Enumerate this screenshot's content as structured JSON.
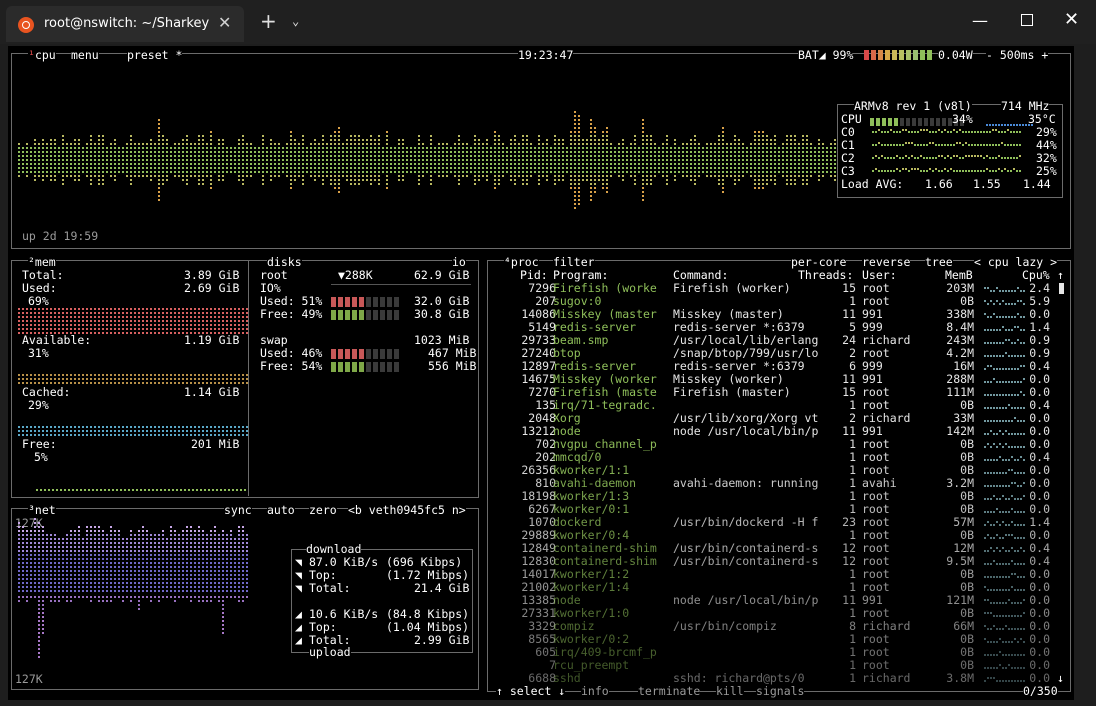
{
  "window": {
    "tab_title": "root@nswitch: ~/Sharkey",
    "new_tab": "+",
    "dropdown": "⌄",
    "minimize": "—",
    "close": "✕"
  },
  "cpu": {
    "header_cpu": "¹cpu",
    "header_menu": "menu",
    "header_preset": "preset *",
    "clock": "19:23:47",
    "battery_label": "BAT◢ 99%",
    "power": "0.04W",
    "interval": "- 500ms +",
    "uptime": "up 2d 19:59",
    "model": "ARMv8 rev 1 (v8l)",
    "freq": "714 MHz",
    "cores": [
      {
        "label": "CPU",
        "pct": "34%",
        "temp": "35°C",
        "value": 0.34
      },
      {
        "label": "C0",
        "pct": "29%",
        "value": 0.29
      },
      {
        "label": "C1",
        "pct": "44%",
        "value": 0.44
      },
      {
        "label": "C2",
        "pct": "32%",
        "value": 0.32
      },
      {
        "label": "C3",
        "pct": "25%",
        "value": 0.25
      }
    ],
    "load_label": "Load AVG:",
    "load": [
      "1.66",
      "1.55",
      "1.44"
    ]
  },
  "mem": {
    "header": "²mem",
    "total_label": "Total:",
    "total": "3.89 GiB",
    "used_label": "Used:",
    "used": "2.69 GiB",
    "used_pct": "69%",
    "avail_label": "Available:",
    "avail": "1.19 GiB",
    "avail_pct": "31%",
    "cached_label": "Cached:",
    "cached": "1.14 GiB",
    "cached_pct": "29%",
    "free_label": "Free:",
    "free": "201 MiB",
    "free_pct": "5%"
  },
  "disks": {
    "header": "disks",
    "io": "io",
    "root_label": "root",
    "root_io": "▼288K",
    "root_size": "62.9 GiB",
    "io_label": "IO%",
    "used_label": "Used: 51%",
    "used": "32.0 GiB",
    "used_value": 0.51,
    "free_label": "Free: 49%",
    "free": "30.8 GiB",
    "free_value": 0.49,
    "swap_label": "swap",
    "swap_size": "1023 MiB",
    "swap_used_label": "Used: 46%",
    "swap_used": "467 MiB",
    "swap_used_value": 0.46,
    "swap_free_label": "Free: 54%",
    "swap_free": "556 MiB",
    "swap_free_value": 0.54
  },
  "net": {
    "header": "³net",
    "sync": "sync",
    "auto": "auto",
    "zero": "zero",
    "iface": "<b veth0945fc5 n>",
    "scale_top": "127K",
    "scale_bottom": "127K",
    "download_title": "download",
    "dl_rate": "87.0 KiB/s",
    "dl_kbps": "(696 Kibps)",
    "dl_top_label": "Top:",
    "dl_top": "(1.72 Mibps)",
    "dl_total_label": "Total:",
    "dl_total": "21.4 GiB",
    "ul_rate": "10.6 KiB/s",
    "ul_kbps": "(84.8 Kibps)",
    "ul_top_label": "Top:",
    "ul_top": "(1.04 Mibps)",
    "ul_total_label": "Total:",
    "ul_total": "2.99 GiB",
    "upload_title": "upload"
  },
  "proc": {
    "header": "⁴proc",
    "filter": "filter",
    "per_core": "per-core",
    "reverse": "reverse",
    "tree": "tree",
    "sort": "< cpu lazy >",
    "columns": [
      "Pid:",
      "Program:",
      "Command:",
      "Threads:",
      "User:",
      "MemB",
      "Cpu%"
    ],
    "rows": [
      {
        "pid": "7296",
        "prog": "Firefish (worke",
        "cmd": "Firefish (worker)",
        "thr": "15",
        "user": "root",
        "mem": "203M",
        "cpu": "2.4"
      },
      {
        "pid": "207",
        "prog": "sugov:0",
        "cmd": "",
        "thr": "1",
        "user": "root",
        "mem": "0B",
        "cpu": "5.9"
      },
      {
        "pid": "14086",
        "prog": "Misskey (master",
        "cmd": "Misskey (master)",
        "thr": "11",
        "user": "991",
        "mem": "338M",
        "cpu": "0.0"
      },
      {
        "pid": "5149",
        "prog": "redis-server",
        "cmd": "redis-server *:6379",
        "thr": "5",
        "user": "999",
        "mem": "8.4M",
        "cpu": "1.4"
      },
      {
        "pid": "29733",
        "prog": "beam.smp",
        "cmd": "/usr/local/lib/erlang",
        "thr": "24",
        "user": "richard",
        "mem": "243M",
        "cpu": "0.9"
      },
      {
        "pid": "27240",
        "prog": "btop",
        "cmd": "/snap/btop/799/usr/lo",
        "thr": "2",
        "user": "root",
        "mem": "4.2M",
        "cpu": "0.9"
      },
      {
        "pid": "12897",
        "prog": "redis-server",
        "cmd": "redis-server *:6379",
        "thr": "6",
        "user": "999",
        "mem": "16M",
        "cpu": "0.4"
      },
      {
        "pid": "14675",
        "prog": "Misskey (worker",
        "cmd": "Misskey (worker)",
        "thr": "11",
        "user": "991",
        "mem": "288M",
        "cpu": "0.0"
      },
      {
        "pid": "7270",
        "prog": "Firefish (maste",
        "cmd": "Firefish (master)",
        "thr": "15",
        "user": "root",
        "mem": "111M",
        "cpu": "0.0"
      },
      {
        "pid": "135",
        "prog": "irq/71-tegradc.",
        "cmd": "",
        "thr": "1",
        "user": "root",
        "mem": "0B",
        "cpu": "0.4"
      },
      {
        "pid": "2048",
        "prog": "Xorg",
        "cmd": "/usr/lib/xorg/Xorg vt",
        "thr": "2",
        "user": "richard",
        "mem": "33M",
        "cpu": "0.0"
      },
      {
        "pid": "13212",
        "prog": "node",
        "cmd": "node /usr/local/bin/p",
        "thr": "11",
        "user": "991",
        "mem": "142M",
        "cpu": "0.0"
      },
      {
        "pid": "702",
        "prog": "nvgpu_channel_p",
        "cmd": "",
        "thr": "1",
        "user": "root",
        "mem": "0B",
        "cpu": "0.0"
      },
      {
        "pid": "202",
        "prog": "mmcqd/0",
        "cmd": "",
        "thr": "1",
        "user": "root",
        "mem": "0B",
        "cpu": "0.4"
      },
      {
        "pid": "26356",
        "prog": "kworker/1:1",
        "cmd": "",
        "thr": "1",
        "user": "root",
        "mem": "0B",
        "cpu": "0.0"
      },
      {
        "pid": "810",
        "prog": "avahi-daemon",
        "cmd": "avahi-daemon: running",
        "thr": "1",
        "user": "avahi",
        "mem": "3.2M",
        "cpu": "0.0"
      },
      {
        "pid": "18198",
        "prog": "kworker/1:3",
        "cmd": "",
        "thr": "1",
        "user": "root",
        "mem": "0B",
        "cpu": "0.0"
      },
      {
        "pid": "6267",
        "prog": "kworker/0:1",
        "cmd": "",
        "thr": "1",
        "user": "root",
        "mem": "0B",
        "cpu": "0.0"
      },
      {
        "pid": "1070",
        "prog": "dockerd",
        "cmd": "/usr/bin/dockerd -H f",
        "thr": "23",
        "user": "root",
        "mem": "57M",
        "cpu": "1.4"
      },
      {
        "pid": "29889",
        "prog": "kworker/0:4",
        "cmd": "",
        "thr": "1",
        "user": "root",
        "mem": "0B",
        "cpu": "0.0"
      },
      {
        "pid": "12849",
        "prog": "containerd-shim",
        "cmd": "/usr/bin/containerd-s",
        "thr": "12",
        "user": "root",
        "mem": "12M",
        "cpu": "0.4"
      },
      {
        "pid": "12830",
        "prog": "containerd-shim",
        "cmd": "/usr/bin/containerd-s",
        "thr": "12",
        "user": "root",
        "mem": "9.5M",
        "cpu": "0.4"
      },
      {
        "pid": "14017",
        "prog": "kworker/1:2",
        "cmd": "",
        "thr": "1",
        "user": "root",
        "mem": "0B",
        "cpu": "0.0"
      },
      {
        "pid": "21002",
        "prog": "kworker/1:4",
        "cmd": "",
        "thr": "1",
        "user": "root",
        "mem": "0B",
        "cpu": "0.0"
      },
      {
        "pid": "13385",
        "prog": "node",
        "cmd": "node /usr/local/bin/p",
        "thr": "11",
        "user": "991",
        "mem": "121M",
        "cpu": "0.0"
      },
      {
        "pid": "27331",
        "prog": "kworker/1:0",
        "cmd": "",
        "thr": "1",
        "user": "root",
        "mem": "0B",
        "cpu": "0.0"
      },
      {
        "pid": "3329",
        "prog": "compiz",
        "cmd": "/usr/bin/compiz",
        "thr": "8",
        "user": "richard",
        "mem": "66M",
        "cpu": "0.0"
      },
      {
        "pid": "8565",
        "prog": "kworker/0:2",
        "cmd": "",
        "thr": "1",
        "user": "root",
        "mem": "0B",
        "cpu": "0.0"
      },
      {
        "pid": "605",
        "prog": "irq/409-brcmf_p",
        "cmd": "",
        "thr": "1",
        "user": "root",
        "mem": "0B",
        "cpu": "0.0"
      },
      {
        "pid": "7",
        "prog": "rcu_preempt",
        "cmd": "",
        "thr": "1",
        "user": "root",
        "mem": "0B",
        "cpu": "0.0"
      },
      {
        "pid": "6688",
        "prog": "sshd",
        "cmd": "sshd: richard@pts/0",
        "thr": "1",
        "user": "richard",
        "mem": "3.8M",
        "cpu": "0.0"
      }
    ],
    "footer_select": "↑ select ↓",
    "footer_info": "info",
    "footer_terminate": "terminate",
    "footer_kill": "kill",
    "footer_signals": "signals",
    "footer_count": "0/350"
  }
}
